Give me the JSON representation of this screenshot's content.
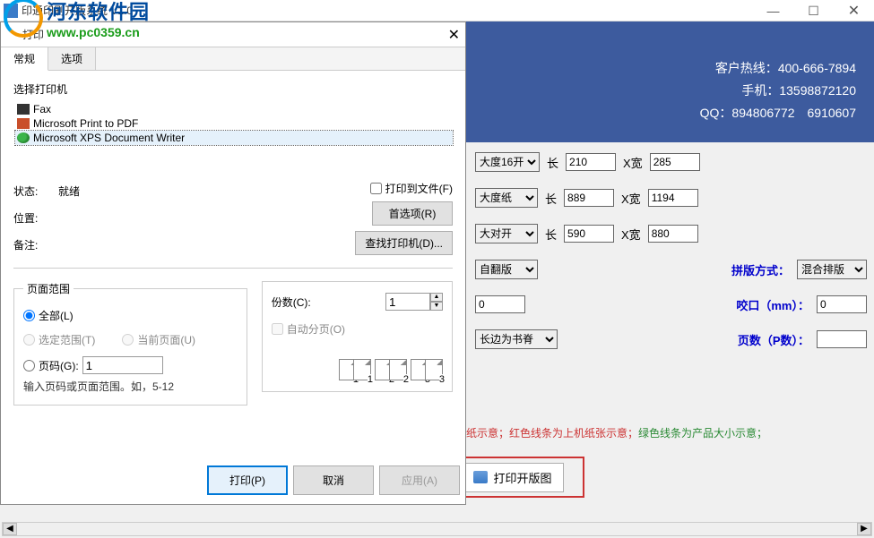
{
  "window": {
    "title": "印通印刷开版系统 V1.0"
  },
  "logo": {
    "brand_cn": "河东软件园",
    "brand_url": "www.pc0359.cn"
  },
  "banner": {
    "hotline_label": "客户热线：",
    "hotline_value": "400-666-7894",
    "mobile_label": "手机：",
    "mobile_value": "13598872120",
    "qq_label": "QQ：",
    "qq_value": "894806772　6910607"
  },
  "print_dialog": {
    "title": "打印",
    "tabs": {
      "general": "常规",
      "options": "选项"
    },
    "select_printer_label": "选择打印机",
    "printers": [
      "Fax",
      "Microsoft Print to PDF",
      "Microsoft XPS Document Writer"
    ],
    "status": {
      "label": "状态:",
      "value": "就绪"
    },
    "location": {
      "label": "位置:",
      "value": ""
    },
    "comment": {
      "label": "备注:",
      "value": ""
    },
    "print_to_file": "打印到文件(F)",
    "preferences_btn": "首选项(R)",
    "find_printer_btn": "查找打印机(D)...",
    "page_range": {
      "legend": "页面范围",
      "all": "全部(L)",
      "selection": "选定范围(T)",
      "current": "当前页面(U)",
      "pages": "页码(G):",
      "pages_value": "1",
      "hint": "输入页码或页面范围。如，5-12"
    },
    "copies": {
      "count_label": "份数(C):",
      "count_value": "1",
      "collate_label": "自动分页(O)",
      "icons": [
        "1",
        "2",
        "3"
      ]
    },
    "buttons": {
      "print": "打印(P)",
      "cancel": "取消",
      "apply": "应用(A)"
    }
  },
  "form": {
    "size1": {
      "select": "大度16开",
      "len_label": "长",
      "len": "210",
      "w_label": "X宽",
      "w": "285"
    },
    "size2": {
      "select": "大度纸",
      "len_label": "长",
      "len": "889",
      "w_label": "X宽",
      "w": "1194"
    },
    "size3": {
      "select": "大对开",
      "len_label": "长",
      "len": "590",
      "w_label": "X宽",
      "w": "880"
    },
    "row4": {
      "flip": "自翻版",
      "layout_label": "拼版方式：",
      "layout_value": "混合排版"
    },
    "row5": {
      "input1": "0",
      "bite_label": "咬口（mm）：",
      "bite_value": "0"
    },
    "row6": {
      "spine": "长边为书脊",
      "pages_label": "页数（P数）：",
      "pages_value": ""
    }
  },
  "legend_hint": {
    "text_red": "纸示意；红色线条为上机纸张示意；",
    "text_green": "绿色线条为产品大小示意；"
  },
  "print_layout_btn": {
    "label": "打印开版图"
  }
}
